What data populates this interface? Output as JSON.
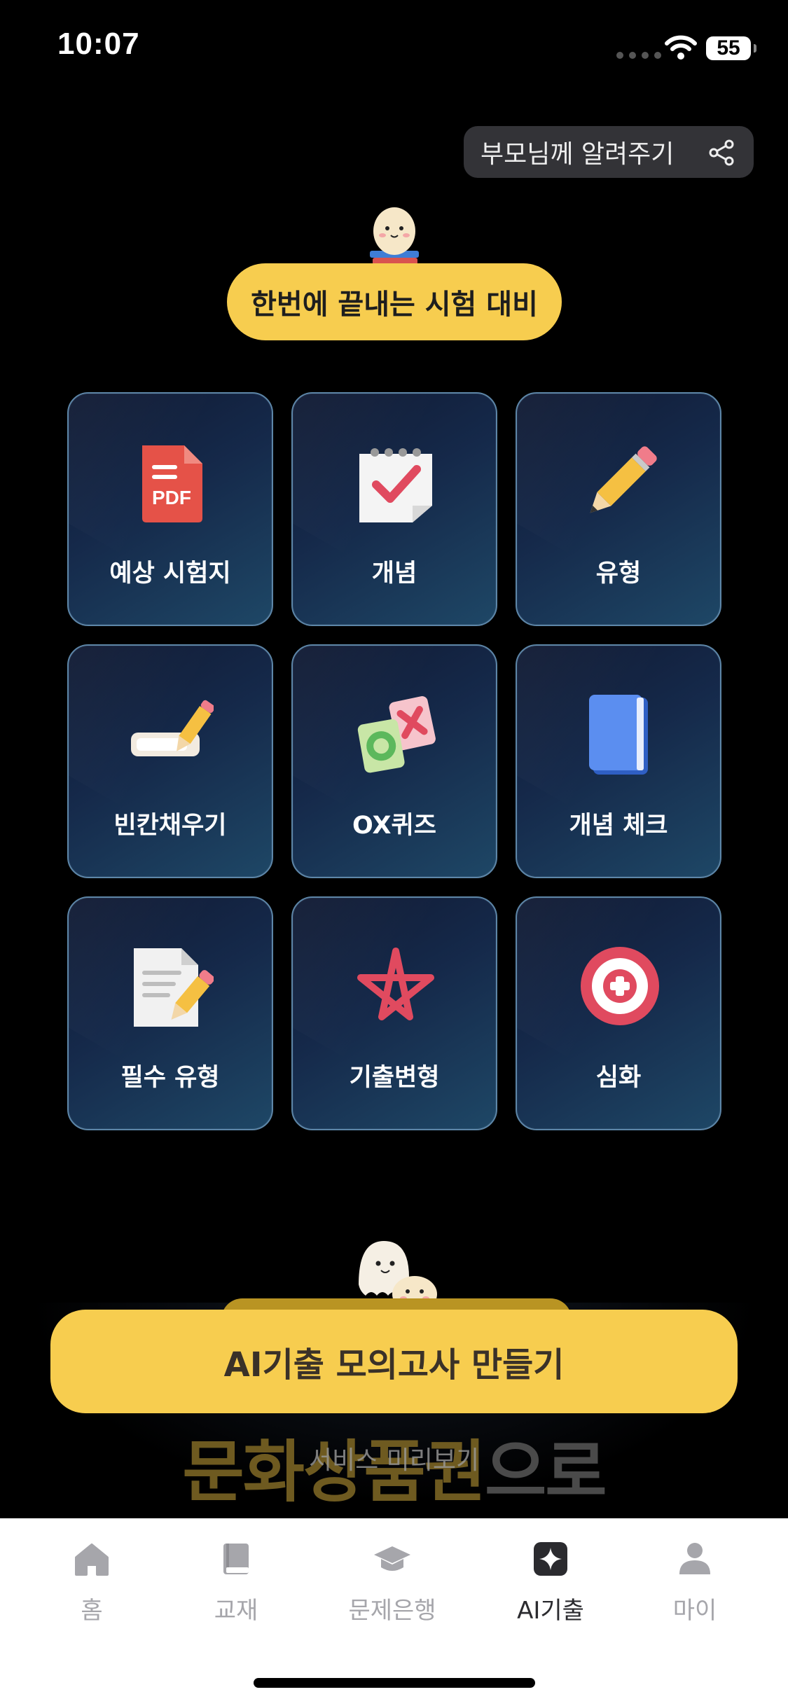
{
  "status_bar": {
    "time": "10:07",
    "battery": "55"
  },
  "share_button": {
    "label": "부모님께 알려주기",
    "icon": "share-icon"
  },
  "section_title": "한번에 끝내는 시험 대비",
  "menu_items": [
    {
      "label": "예상 시험지",
      "icon": "pdf-document-icon"
    },
    {
      "label": "개념",
      "icon": "calendar-check-icon"
    },
    {
      "label": "유형",
      "icon": "pencil-icon"
    },
    {
      "label": "빈칸채우기",
      "icon": "fill-blank-pencil-icon"
    },
    {
      "label": "OX퀴즈",
      "icon": "ox-cards-icon"
    },
    {
      "label": "개념 체크",
      "icon": "blue-book-icon"
    },
    {
      "label": "필수 유형",
      "icon": "document-pencil-icon"
    },
    {
      "label": "기출변형",
      "icon": "red-star-icon"
    },
    {
      "label": "심화",
      "icon": "plus-target-icon"
    }
  ],
  "cta": {
    "label": "AI기출 모의고사 만들기"
  },
  "promo": {
    "highlight": "문화상품권",
    "rest": "으로",
    "overlay": "서비스 미리보기"
  },
  "tab_bar": {
    "tabs": [
      {
        "label": "홈",
        "icon": "home-icon",
        "active": false
      },
      {
        "label": "교재",
        "icon": "book-icon",
        "active": false
      },
      {
        "label": "문제은행",
        "icon": "graduation-cap-icon",
        "active": false
      },
      {
        "label": "AI기출",
        "icon": "ai-sparkle-icon",
        "active": true
      },
      {
        "label": "마이",
        "icon": "person-icon",
        "active": false
      }
    ]
  },
  "colors": {
    "accent_yellow": "#f7cd4f",
    "tile_border": "#5d86a8",
    "tab_active": "#2b2b2f",
    "tab_inactive": "#a6a6ab"
  }
}
